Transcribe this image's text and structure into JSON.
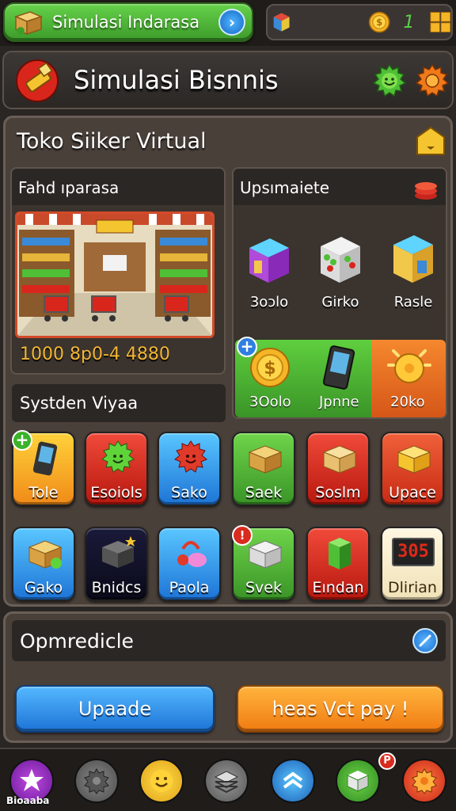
{
  "top_bar": {
    "breadcrumb": "Simulasi Indarasa",
    "go_icon": "chevron-right-icon",
    "resource_count": "1"
  },
  "title_bar": {
    "title": "Simulasi Bisnnis"
  },
  "store": {
    "title": "Toko Siiker Virtual",
    "shop_view": {
      "header": "Fahd ıparasa",
      "stats": "1000 8p0-4 4880"
    },
    "upgrade_panel": {
      "header": "Upsımaiete",
      "buildings": [
        {
          "label": "3oɔlo"
        },
        {
          "label": "Girko"
        },
        {
          "label": "Rasle"
        }
      ],
      "green_items": [
        {
          "label": "3Oolo"
        },
        {
          "label": "Jpnne"
        }
      ],
      "orange_item": {
        "label": "20ko"
      }
    },
    "system_header": "Systden Viyaa",
    "tiles_row1": [
      {
        "label": "Tole"
      },
      {
        "label": "Esoiols"
      },
      {
        "label": "Sako"
      },
      {
        "label": "Saek"
      },
      {
        "label": "Soslm"
      },
      {
        "label": "Upace"
      }
    ],
    "tiles_row2": [
      {
        "label": "Gako"
      },
      {
        "label": "Bnidcs"
      },
      {
        "label": "Paola"
      },
      {
        "label": "Svek"
      },
      {
        "label": "Eından"
      },
      {
        "label": "Dlirian"
      }
    ],
    "badge_red": "!",
    "tile_display": "305"
  },
  "options": {
    "header": "Opmredicle",
    "upgrade_button": "Upaade",
    "pay_button": "heas Vct pay !"
  },
  "bottom_nav": {
    "home_label": "Bioaaba",
    "badge": "P"
  },
  "colors": {
    "accent_green": "#4fbf36",
    "accent_orange": "#f08a22",
    "accent_blue": "#2a86e0",
    "panel_bg": "#4a403a"
  }
}
